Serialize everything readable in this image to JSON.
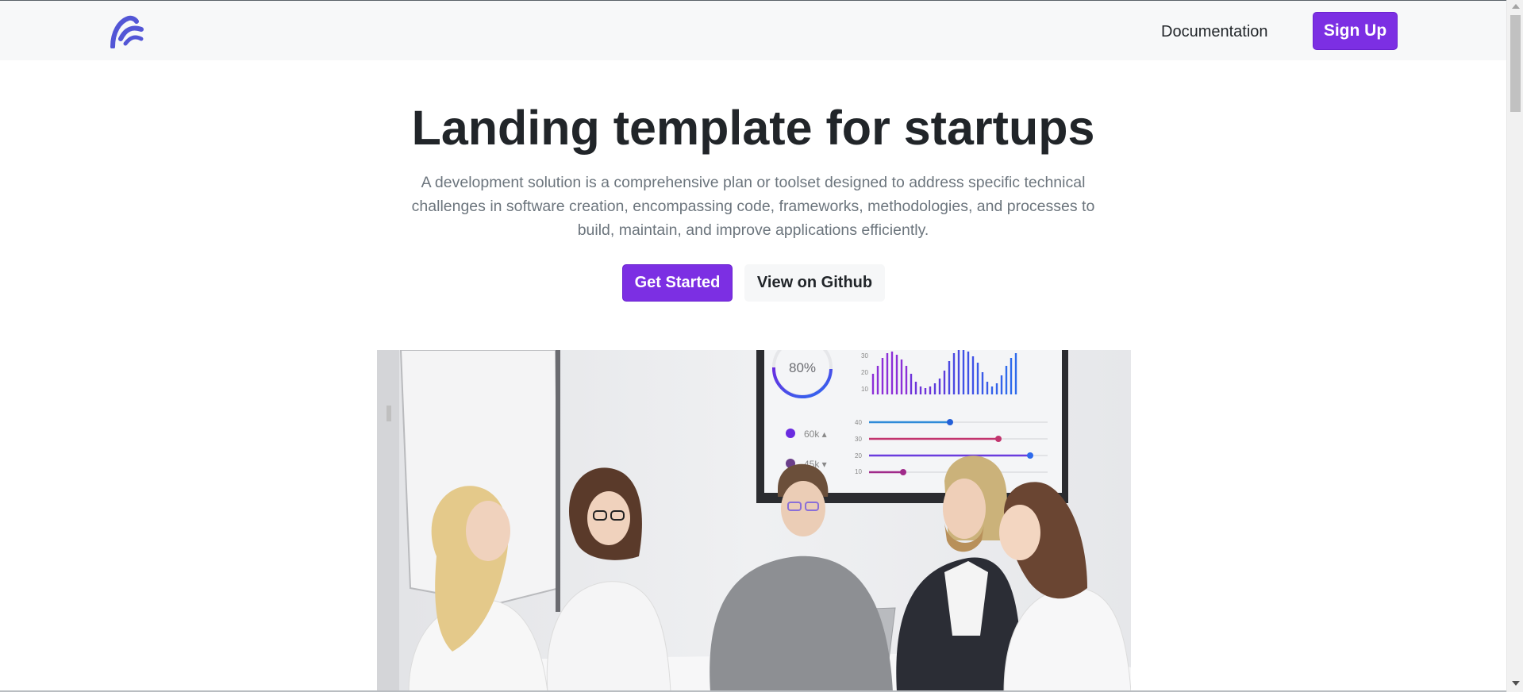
{
  "header": {
    "logo_name": "brand-logo",
    "nav_link": "Documentation",
    "signup_label": "Sign Up"
  },
  "hero": {
    "title": "Landing template for startups",
    "description": "A development solution is a comprehensive plan or toolset designed to address specific technical challenges in software creation, encompassing code, frameworks, methodologies, and processes to build, maintain, and improve applications efficiently.",
    "primary_cta": "Get Started",
    "secondary_cta": "View on Github"
  },
  "image": {
    "dashboard_percent": "80%",
    "stat_1": "60k",
    "stat_2": "45k",
    "y_ticks_top": [
      "30",
      "20",
      "10"
    ],
    "y_ticks_bottom": [
      "40",
      "30",
      "20",
      "10"
    ]
  },
  "colors": {
    "accent": "#7c2fe3",
    "text_dark": "#212529",
    "text_muted": "#6c757d",
    "navbar_bg": "#f7f8f9",
    "logo": "#5356d6"
  }
}
